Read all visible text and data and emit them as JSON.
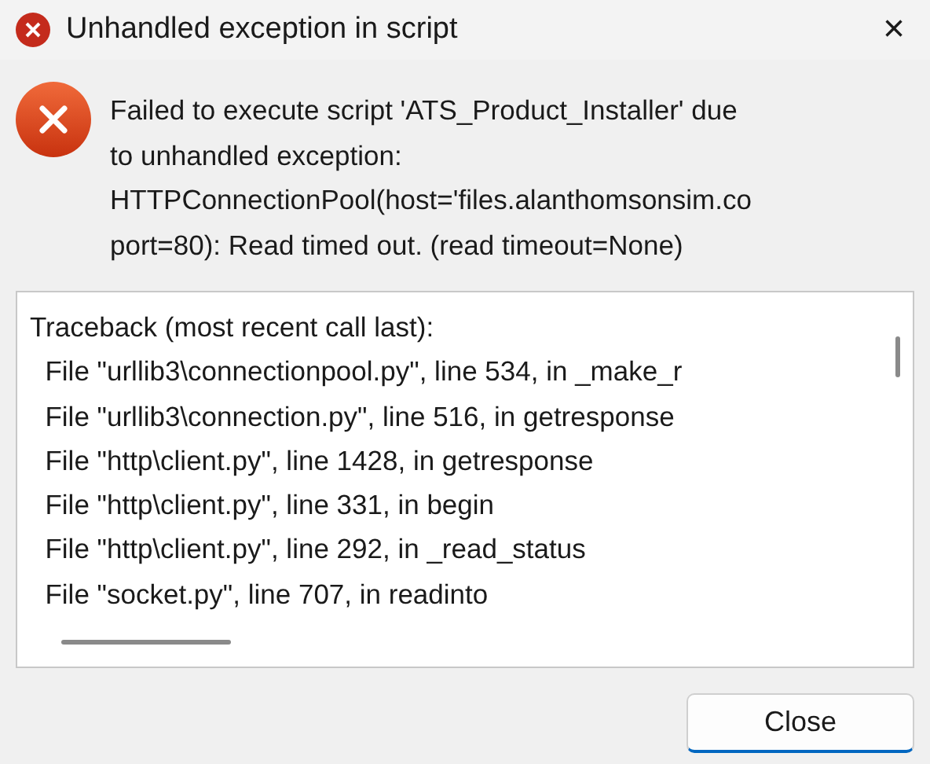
{
  "window": {
    "title": "Unhandled exception in script",
    "close": "×"
  },
  "message_lines": [
    "Failed to execute script 'ATS_Product_Installer' due",
    "to unhandled exception:",
    "HTTPConnectionPool(host='files.alanthomsonsim.co",
    "port=80): Read timed out. (read timeout=None)"
  ],
  "traceback_lines": [
    "Traceback (most recent call last):",
    "  File \"urllib3\\connectionpool.py\", line 534, in _make_r",
    "  File \"urllib3\\connection.py\", line 516, in getresponse",
    "  File \"http\\client.py\", line 1428, in getresponse",
    "  File \"http\\client.py\", line 331, in begin",
    "  File \"http\\client.py\", line 292, in _read_status",
    "  File \"socket.py\", line 707, in readinto"
  ],
  "buttons": [
    "Close"
  ]
}
